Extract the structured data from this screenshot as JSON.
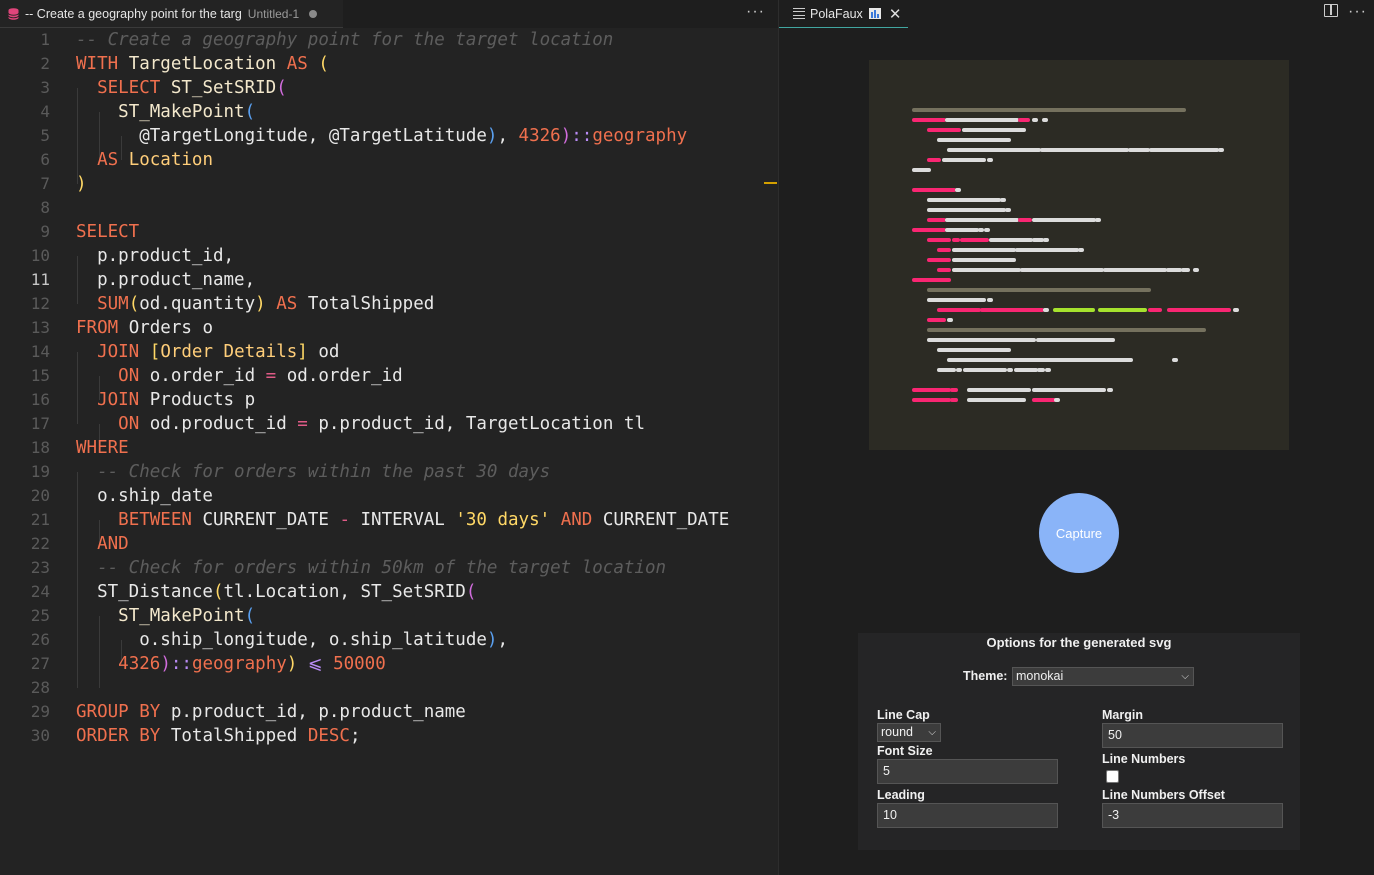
{
  "editor": {
    "tab": {
      "title": "-- Create a geography point for the targ",
      "description": "Untitled-1",
      "more_glyph": "···"
    },
    "active_line": 11,
    "line_numbers": [
      "1",
      "2",
      "3",
      "4",
      "5",
      "6",
      "7",
      "8",
      "9",
      "10",
      "11",
      "12",
      "13",
      "14",
      "15",
      "16",
      "17",
      "18",
      "19",
      "20",
      "21",
      "22",
      "23",
      "24",
      "25",
      "26",
      "27",
      "28",
      "29",
      "30"
    ]
  },
  "preview": {
    "tab": {
      "title": "PolaFaux",
      "close_glyph": "✕"
    },
    "more_glyph": "···",
    "capture_label": "Capture",
    "options": {
      "title": "Options for the generated svg",
      "theme_label": "Theme:",
      "theme_value": "monokai",
      "line_cap_label": "Line Cap",
      "line_cap_value": "round",
      "margin_label": "Margin",
      "margin_value": "50",
      "font_size_label": "Font Size",
      "font_size_value": "5",
      "line_numbers_label": "Line Numbers",
      "line_numbers_checked": false,
      "leading_label": "Leading",
      "leading_value": "10",
      "line_numbers_offset_label": "Line Numbers Offset",
      "line_numbers_offset_value": "-3"
    },
    "colors": {
      "svg_background": "#2c2b24",
      "comment": "#75715e",
      "keyword": "#f92672",
      "text": "#dcdcdc",
      "string": "#a6e22e"
    }
  }
}
